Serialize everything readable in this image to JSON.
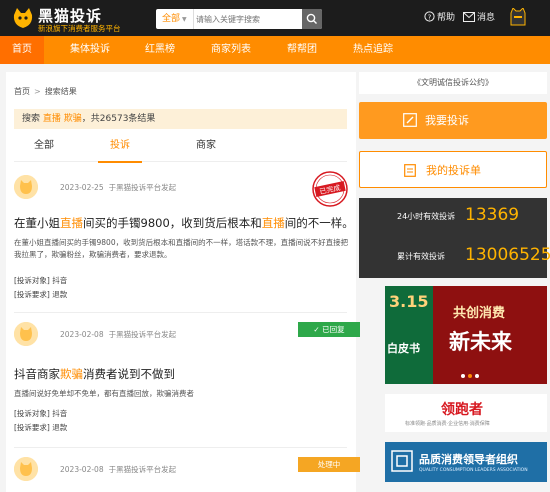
{
  "header": {
    "logo_title": "黑猫投诉",
    "logo_subtitle": "新浪旗下消费者服务平台",
    "search_scope": "全部",
    "search_placeholder": "请输入关键字搜索",
    "help_label": "帮助",
    "message_label": "消息"
  },
  "nav": {
    "items": [
      "首页",
      "集体投诉",
      "红黑榜",
      "商家列表",
      "帮帮团",
      "热点追踪"
    ],
    "active": "首页"
  },
  "breadcrumb": {
    "home": "首页",
    "sep": ">",
    "current": "搜索结果"
  },
  "result": {
    "prefix": "搜索",
    "keyword1": "直播",
    "keyword2": "欺骗",
    "suffix": "，共26573条结果"
  },
  "tabs": [
    "全部",
    "投诉",
    "商家"
  ],
  "active_tab": "投诉",
  "complaints": [
    {
      "date": "2023-02-25",
      "via": "于黑猫投诉平台发起",
      "status": "已完成",
      "title_parts": [
        "在董小姐",
        "直播",
        "间买的手镯9800，收到货后根本和",
        "直播",
        "间的不一样。"
      ],
      "description": "在董小姐直播间买的手镯9800，收到货后根本和直播间的不一样，塔话款不理，直播间说不好直接把我拉黑了，欺骗粉丝，欺骗消费者，要求退款。",
      "target_label": "[投诉对象]",
      "target": "抖音",
      "demand_label": "[投诉要求]",
      "demand": "退款"
    },
    {
      "date": "2023-02-08",
      "via": "于黑猫投诉平台发起",
      "status": "已回复",
      "title_parts": [
        "抖音商家",
        "欺骗",
        "消费者说到不做到"
      ],
      "description": "直播间说好免单却不免单，都有直播回放，欺骗消费者",
      "target_label": "[投诉对象]",
      "target": "抖音",
      "demand_label": "[投诉要求]",
      "demand": "退款"
    },
    {
      "date": "2023-02-08",
      "via": "于黑猫投诉平台发起",
      "status": "处理中"
    }
  ],
  "sidebar": {
    "pledge": "《文明诚信投诉公约》",
    "complain_button": "我要投诉",
    "my_complaints_button": "我的投诉单",
    "stats": [
      {
        "label": "24小时有效投诉",
        "value": "13369"
      },
      {
        "label": "累计有效投诉",
        "value": "13006525"
      }
    ],
    "ad1_texts": [
      "3.15",
      "共创消费",
      "新未来",
      "白皮书"
    ],
    "ad2_text": "领跑者",
    "ad2_sub": "标准领跑·品质消费·企业信用·消费保障",
    "ad3_title": "品质消费领导者组织",
    "ad3_sub": "QUALITY CONSUMPTION LEADERS ASSOCIATION"
  },
  "colors": {
    "brand_orange": "#ff8c00",
    "top_bar": "#1c1c1c",
    "status_done": "#d71921",
    "status_replied": "#2ea84a",
    "status_processing": "#f5a623"
  }
}
